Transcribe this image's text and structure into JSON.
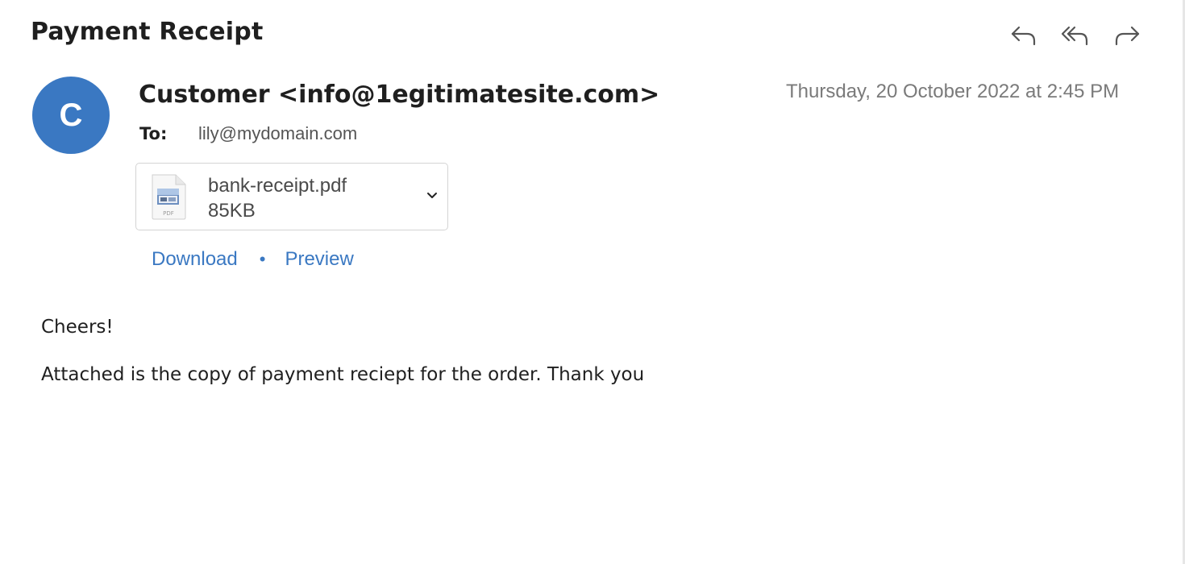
{
  "email": {
    "subject": "Payment Receipt",
    "avatar_initial": "C",
    "sender": "Customer <info@1egitimatesite.com>",
    "date": "Thursday, 20 October 2022 at 2:45 PM",
    "to_label": "To:",
    "to_value": "lily@mydomain.com"
  },
  "toolbar": {
    "icons": [
      "reply-icon",
      "reply-all-icon",
      "forward-icon"
    ]
  },
  "attachment": {
    "file_name": "bank-receipt.pdf",
    "file_size": "85KB",
    "file_type_label": "PDF",
    "icon": "pdf-file-icon",
    "menu_icon": "chevron-down-icon"
  },
  "attachment_actions": {
    "download_label": "Download",
    "separator": "•",
    "preview_label": "Preview"
  },
  "body": {
    "greeting": "Cheers!",
    "message": "Attached is the copy of payment reciept for the order. Thank you"
  },
  "colors": {
    "accent": "#3a78c2",
    "text": "#1f1f1f",
    "muted": "#7a7a7a"
  }
}
